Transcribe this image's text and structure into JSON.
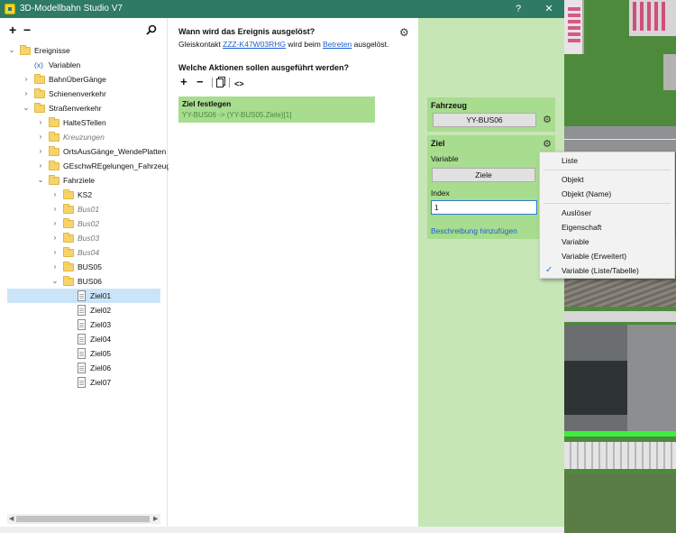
{
  "window": {
    "title": "3D-Modellbahn Studio V7",
    "help_label": "?",
    "close_label": "✕"
  },
  "tree": {
    "add_label": "+",
    "remove_label": "−",
    "search_icon": "search-icon",
    "items": [
      {
        "label": "Ereignisse",
        "caret": "⌄",
        "icon": "folder",
        "style": "normal"
      },
      {
        "label": "Variablen",
        "caret": "",
        "icon": "(x)",
        "style": "normal"
      },
      {
        "label": "BahnÜberGänge",
        "caret": "›",
        "icon": "folder",
        "style": "normal"
      },
      {
        "label": "Schienenverkehr",
        "caret": "›",
        "icon": "folder",
        "style": "normal"
      },
      {
        "label": "Straßenverkehr",
        "caret": "⌄",
        "icon": "folder",
        "style": "normal"
      },
      {
        "label": "HalteSTellen",
        "caret": "›",
        "icon": "folder",
        "style": "normal"
      },
      {
        "label": "Kreuzungen",
        "caret": "›",
        "icon": "folder",
        "style": "italic"
      },
      {
        "label": "OrtsAusGänge_WendePlatten",
        "caret": "›",
        "icon": "folder",
        "style": "normal"
      },
      {
        "label": "GEschwREgelungen_FahrzeugStopp",
        "caret": "›",
        "icon": "folder",
        "style": "normal"
      },
      {
        "label": "Fahrziele",
        "caret": "⌄",
        "icon": "folder",
        "style": "normal"
      },
      {
        "label": "KS2",
        "caret": "›",
        "icon": "folder",
        "style": "normal"
      },
      {
        "label": "Bus01",
        "caret": "›",
        "icon": "folder",
        "style": "italic"
      },
      {
        "label": "Bus02",
        "caret": "›",
        "icon": "folder",
        "style": "italic"
      },
      {
        "label": "Bus03",
        "caret": "›",
        "icon": "folder",
        "style": "italic"
      },
      {
        "label": "Bus04",
        "caret": "›",
        "icon": "folder",
        "style": "italic"
      },
      {
        "label": "BUS05",
        "caret": "›",
        "icon": "folder",
        "style": "normal"
      },
      {
        "label": "BUS06",
        "caret": "⌄",
        "icon": "folder",
        "style": "normal"
      },
      {
        "label": "Ziel01",
        "caret": "",
        "icon": "doc",
        "style": "normal",
        "selected": true
      },
      {
        "label": "Ziel02",
        "caret": "",
        "icon": "doc",
        "style": "normal"
      },
      {
        "label": "Ziel03",
        "caret": "",
        "icon": "doc",
        "style": "normal"
      },
      {
        "label": "Ziel04",
        "caret": "",
        "icon": "doc",
        "style": "normal"
      },
      {
        "label": "Ziel05",
        "caret": "",
        "icon": "doc",
        "style": "normal"
      },
      {
        "label": "Ziel06",
        "caret": "",
        "icon": "doc",
        "style": "normal"
      },
      {
        "label": "Ziel07",
        "caret": "",
        "icon": "doc",
        "style": "normal"
      }
    ]
  },
  "event": {
    "question": "Wann wird das Ereignis ausgelöst?",
    "trigger_prefix": "Gleiskontakt ",
    "trigger_link": "ZZZ-K47W03RHG",
    "trigger_middle": " wird beim ",
    "trigger_action_link": "Betreten",
    "trigger_suffix": " ausgelöst.",
    "actions_title": "Welche Aktionen sollen ausgeführt werden?",
    "toolbar": {
      "add": "+",
      "remove": "−",
      "code": "<>"
    },
    "action_card": {
      "title": "Ziel festlegen",
      "detail": "YY-BUS06 -> (YY-BUS05.Ziele)[1]"
    }
  },
  "properties": {
    "vehicle": {
      "title": "Fahrzeug",
      "value": "YY-BUS06"
    },
    "target": {
      "title": "Ziel",
      "variable_label": "Variable",
      "variable_button": "Ziele",
      "index_label": "Index",
      "index_value": "1",
      "description_link": "Beschreibung hinzufügen"
    }
  },
  "context_menu": {
    "items": [
      {
        "label": "Liste",
        "checked": false
      },
      {
        "label": "Objekt",
        "checked": false
      },
      {
        "label": "Objekt (Name)",
        "checked": false
      },
      {
        "label": "Auslöser",
        "checked": false
      },
      {
        "label": "Eigenschaft",
        "checked": false
      },
      {
        "label": "Variable",
        "checked": false
      },
      {
        "label": "Variable (Erweitert)",
        "checked": false
      },
      {
        "label": "Variable (Liste/Tabelle)",
        "checked": true
      }
    ],
    "check_mark": "✓"
  },
  "colors": {
    "titlebar": "#2e7a63",
    "panel_green": "#c7e6b6",
    "card_green": "#a8dc8e",
    "selection": "#cce4f7",
    "link": "#1d5fcf"
  }
}
